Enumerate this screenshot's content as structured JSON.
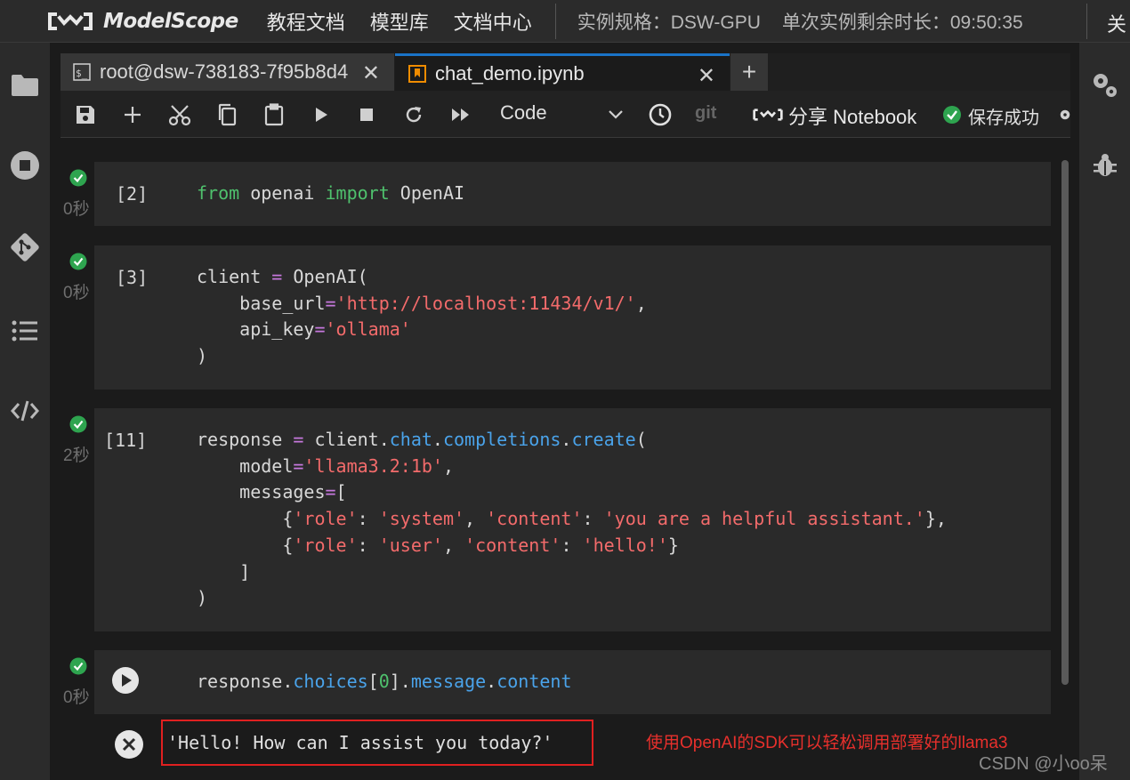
{
  "topbar": {
    "brand": "ModelScope",
    "nav": [
      "教程文档",
      "模型库",
      "文档中心"
    ],
    "instance_spec": "实例规格：DSW-GPU",
    "remaining_time": "单次实例剩余时长：09:50:35",
    "close_label": "关"
  },
  "tabs": [
    {
      "label": "root@dsw-738183-7f95b8d4",
      "icon": "terminal-icon"
    },
    {
      "label": "chat_demo.ipynb",
      "icon": "notebook-icon"
    }
  ],
  "toolbar": {
    "cell_type": "Code",
    "git_label": "git",
    "share_label": "分享 Notebook",
    "save_status": "保存成功"
  },
  "cells": [
    {
      "prompt": "[2]",
      "time": "0秒"
    },
    {
      "prompt": "[3]",
      "time": "0秒"
    },
    {
      "prompt": "[11]",
      "time": "2秒"
    },
    {
      "prompt": "",
      "time": "0秒"
    }
  ],
  "code": {
    "c1": {
      "from": "from",
      "mod": " openai ",
      "import": "import",
      "name": " OpenAI"
    },
    "c2": {
      "l1a": "client ",
      "l1b": "=",
      "l1c": " OpenAI(",
      "l2a": "    base_url",
      "l2b": "=",
      "l2c": "'http://localhost:11434/v1/'",
      "l2d": ",",
      "l3a": "    api_key",
      "l3b": "=",
      "l3c": "'ollama'",
      "l4": ")"
    },
    "c3": {
      "l1a": "response ",
      "l1b": "=",
      "l1c": " client.",
      "l1d": "chat",
      "l1e": ".",
      "l1f": "completions",
      "l1g": ".",
      "l1h": "create",
      "l1i": "(",
      "l2a": "    model",
      "l2b": "=",
      "l2c": "'llama3.2:1b'",
      "l2d": ",",
      "l3a": "    messages",
      "l3b": "=",
      "l3c": "[",
      "l4a": "        {",
      "l4b": "'role'",
      "l4c": ": ",
      "l4d": "'system'",
      "l4e": ", ",
      "l4f": "'content'",
      "l4g": ": ",
      "l4h": "'you are a helpful assistant.'",
      "l4i": "},",
      "l5a": "        {",
      "l5b": "'role'",
      "l5c": ": ",
      "l5d": "'user'",
      "l5e": ", ",
      "l5f": "'content'",
      "l5g": ": ",
      "l5h": "'hello!'",
      "l5i": "}",
      "l6": "    ]",
      "l7": ")"
    },
    "c4": {
      "a": "response.",
      "b": "choices",
      "c": "[",
      "d": "0",
      "e": "].",
      "f": "message",
      "g": ".",
      "h": "content"
    }
  },
  "output": {
    "text": "'Hello! How can I assist you today?'",
    "annotation": "使用OpenAI的SDK可以轻松调用部署好的llama3"
  },
  "watermark": "CSDN @小oo呆",
  "colors": {
    "keyword": "#4fc16d",
    "string": "#f36b6b",
    "attribute": "#4aa3ea",
    "operator": "#c678dd",
    "highlight_box": "#e02020",
    "tab_accent": "#1a73c7"
  }
}
